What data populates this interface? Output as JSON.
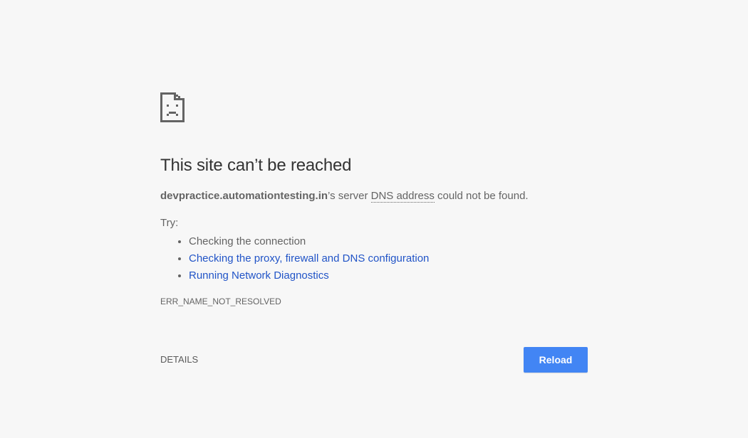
{
  "error": {
    "icon": "sad-page-icon",
    "headline": "This site can’t be reached",
    "summary_host": "devpractice.automationtesting.in",
    "summary_middle": "’s server ",
    "summary_abbr": "DNS address",
    "summary_tail": " could not be found.",
    "try_label": "Try:",
    "suggestions": [
      {
        "label": "Checking the connection",
        "link": false
      },
      {
        "label": "Checking the proxy, firewall and DNS configuration",
        "link": true
      },
      {
        "label": "Running Network Diagnostics",
        "link": true
      }
    ],
    "error_code": "ERR_NAME_NOT_RESOLVED"
  },
  "buttons": {
    "details_label": "DETAILS",
    "reload_label": "Reload"
  },
  "colors": {
    "background": "#f7f7f7",
    "link": "#2154c7",
    "reload_button": "#4285f4"
  }
}
